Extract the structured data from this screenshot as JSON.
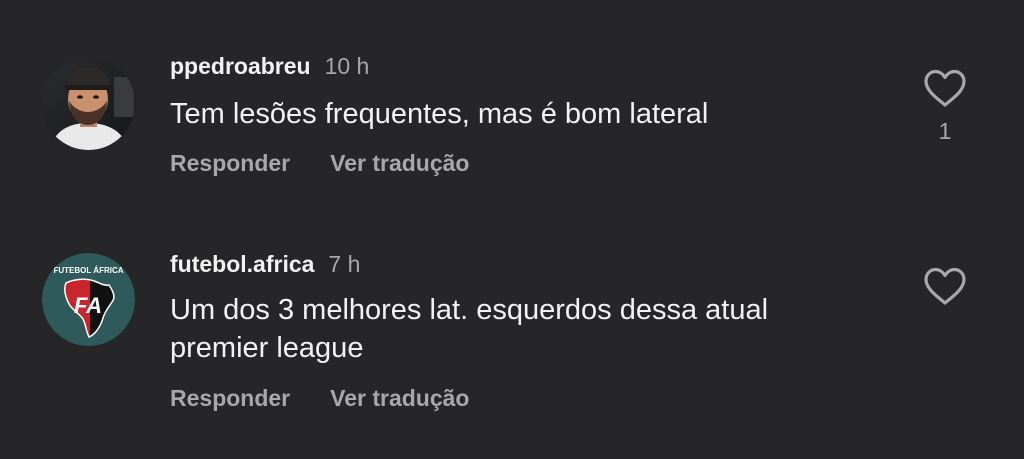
{
  "comments": [
    {
      "username": "ppedroabreu",
      "time": "10 h",
      "text": "Tem lesões frequentes, mas é bom lateral",
      "reply_label": "Responder",
      "translate_label": "Ver tradução",
      "like_icon": "heart-outline-icon",
      "like_count": "1"
    },
    {
      "username": "futebol.africa",
      "time": "7 h",
      "text": "Um dos 3 melhores lat. esquerdos dessa atual premier league",
      "reply_label": "Responder",
      "translate_label": "Ver tradução",
      "like_icon": "heart-outline-icon",
      "avatar_logo": {
        "text_top": "FUTEBOL ÁFRICA",
        "monogram": "FA"
      }
    }
  ],
  "colors": {
    "background": "#262628",
    "primary_text": "#f2f2f2",
    "secondary_text": "#a8a8a8",
    "logo_ring": "#2f5a5b",
    "logo_red": "#c8252c"
  }
}
